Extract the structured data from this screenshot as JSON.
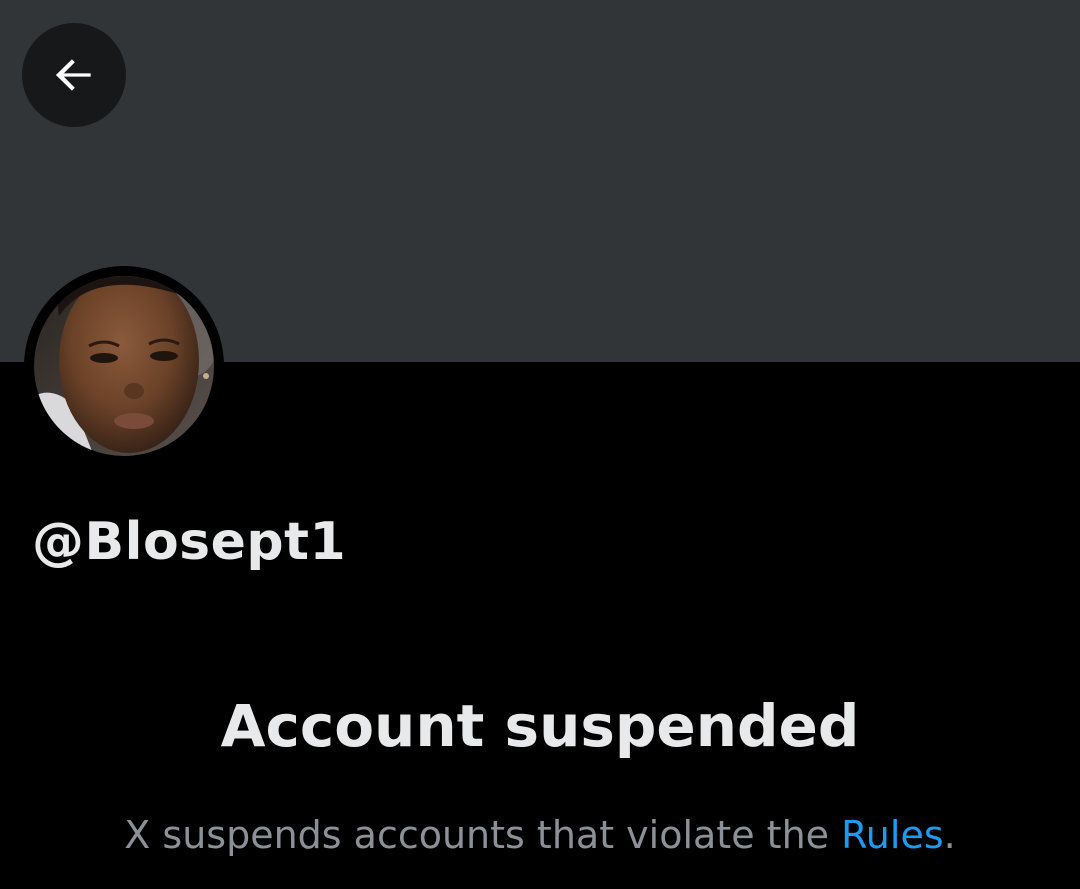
{
  "header": {
    "back_icon": "arrow-left-icon",
    "back_label": "Back"
  },
  "profile": {
    "handle": "@Blosept1"
  },
  "suspension": {
    "title": "Account suspended",
    "message_prefix": "X suspends accounts that violate the ",
    "rules_link": "Rules",
    "message_suffix": "."
  },
  "colors": {
    "banner": "#323538",
    "background": "#000000",
    "primary_text": "#e7e9ea",
    "secondary_text": "#8b9196",
    "link": "#1d9bf0"
  }
}
